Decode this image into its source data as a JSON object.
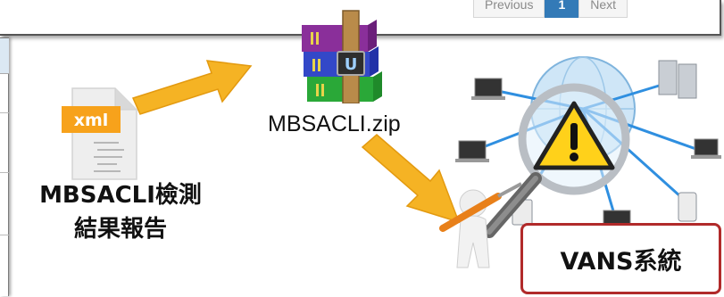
{
  "pager": {
    "prev": "Previous",
    "current": "1",
    "next": "Next"
  },
  "xml_icon": {
    "badge": "xml"
  },
  "xml_report": {
    "line1": "MBSACLI檢測",
    "line2": "結果報告"
  },
  "zip": {
    "label": "MBSACLI.zip"
  },
  "vans": {
    "label": "VANS系統"
  },
  "colors": {
    "arrow": "#f5b324",
    "xml_badge": "#f7a21b",
    "box_border": "#b12a2a",
    "pager_active": "#337ab7"
  }
}
